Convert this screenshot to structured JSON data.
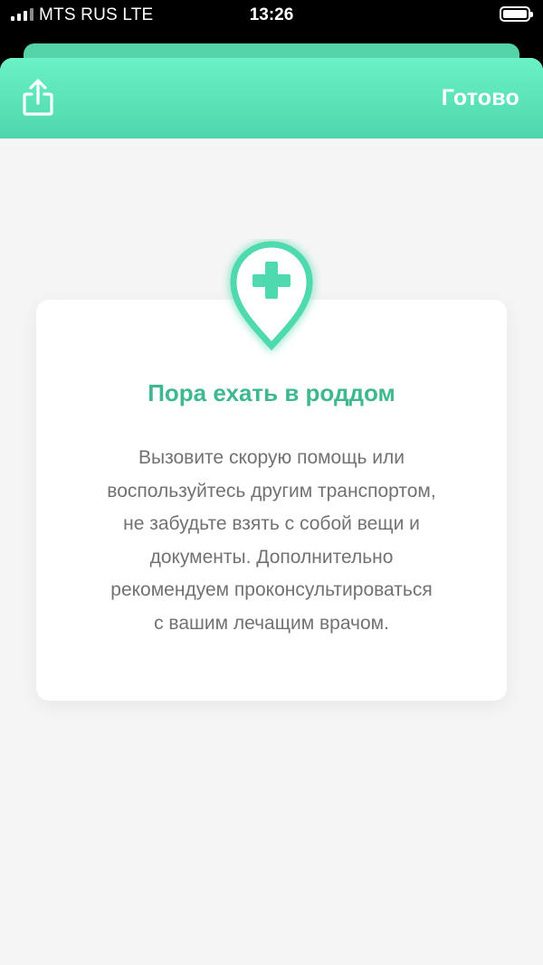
{
  "status_bar": {
    "carrier": "MTS RUS  LTE",
    "time": "13:26"
  },
  "header": {
    "share_icon": "share-icon",
    "done_label": "Готово"
  },
  "card": {
    "icon": "medical-location-pin-icon",
    "title": "Пора ехать в роддом",
    "text": "Вызовите скорую помощь или\nвоспользуйтесь другим транспортом,\nне забудьте взять с собой вещи и\nдокументы. Дополнительно\nрекомендуем проконсультироваться\nс вашим лечащим врачом."
  },
  "colors": {
    "accent": "#3fb891",
    "header_top": "#6af2c6",
    "header_bottom": "#4fd6ac",
    "background": "#f5f5f5"
  }
}
